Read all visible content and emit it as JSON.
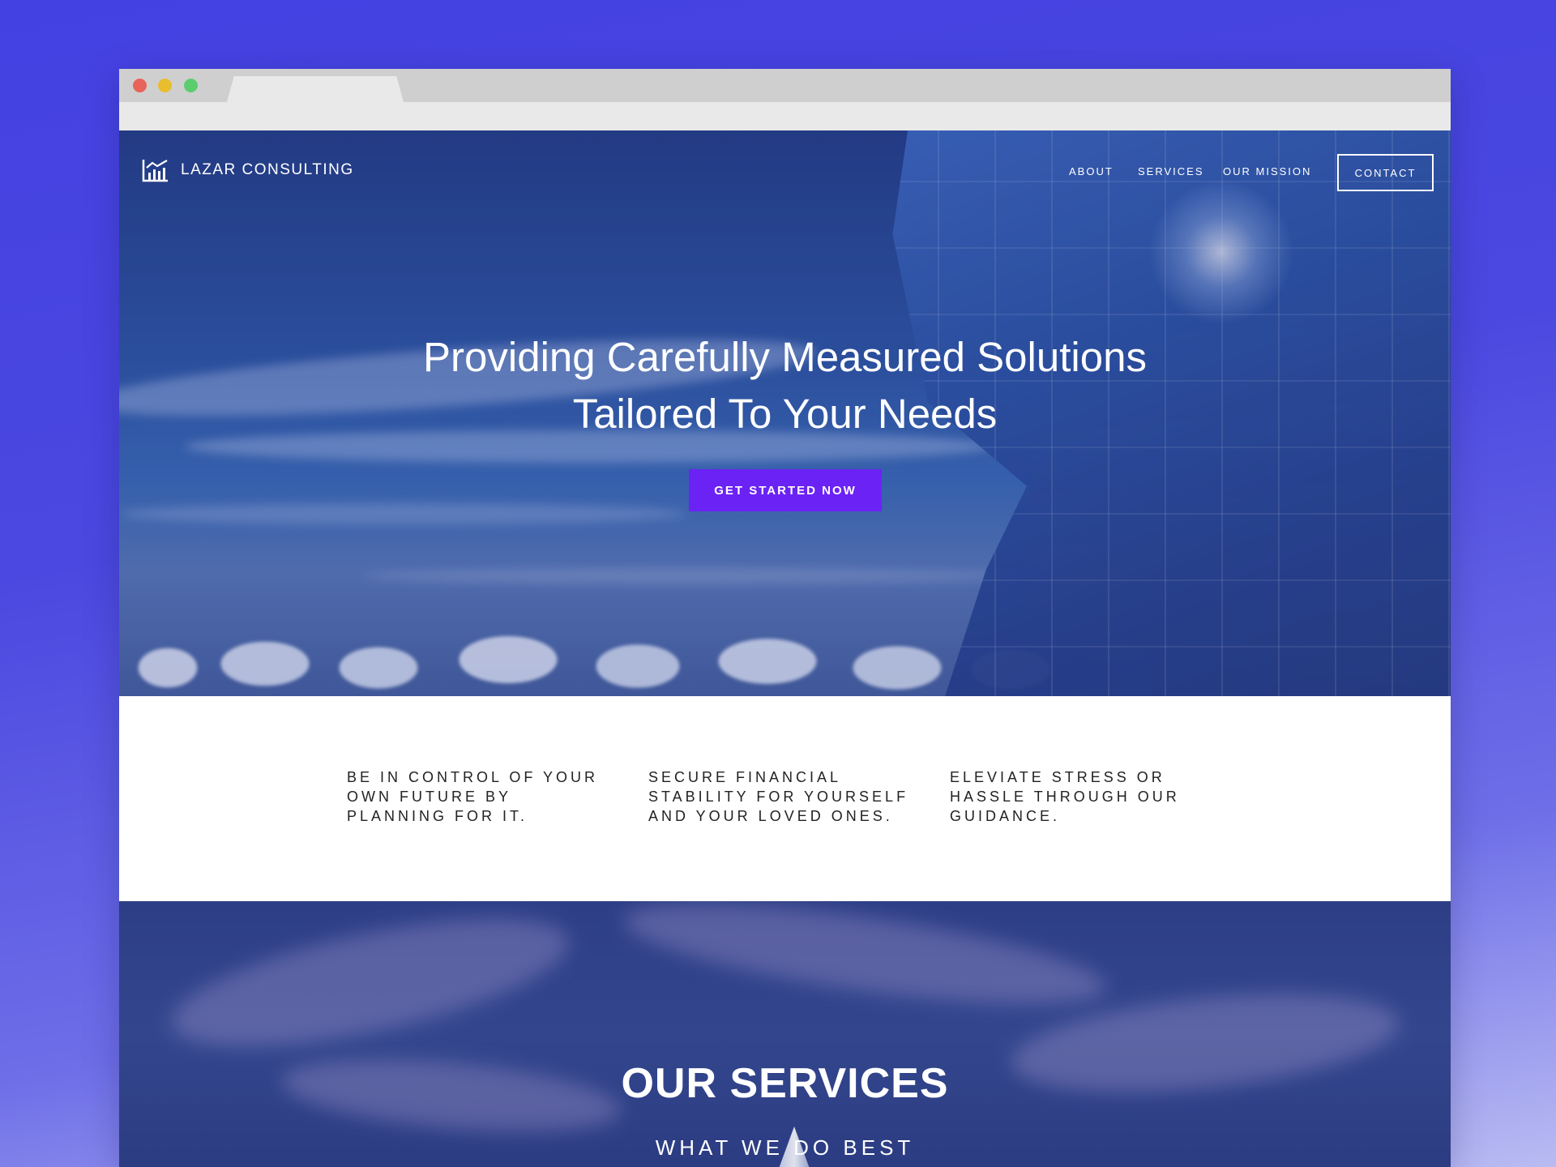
{
  "site": {
    "brand": "LAZAR CONSULTING",
    "nav": [
      "ABOUT",
      "SERVICES",
      "OUR MISSION"
    ],
    "contact_label": "CONTACT"
  },
  "hero": {
    "headline_line1": "Providing Carefully Measured Solutions",
    "headline_line2": "Tailored To Your Needs",
    "cta_label": "GET STARTED NOW"
  },
  "features": [
    "BE IN CONTROL OF YOUR OWN FUTURE BY PLANNING FOR IT.",
    "SECURE FINANCIAL STABILITY FOR YOURSELF AND YOUR LOVED ONES.",
    "ELEVIATE STRESS OR HASSLE THROUGH OUR GUIDANCE."
  ],
  "services": {
    "title": "OUR SERVICES",
    "subtitle": "WHAT WE DO BEST"
  },
  "colors": {
    "background": "#4441e2",
    "cta": "#6b22f5",
    "hero_blue": "#2d57a4"
  },
  "icons": [
    "bar-chart-logo-icon"
  ]
}
